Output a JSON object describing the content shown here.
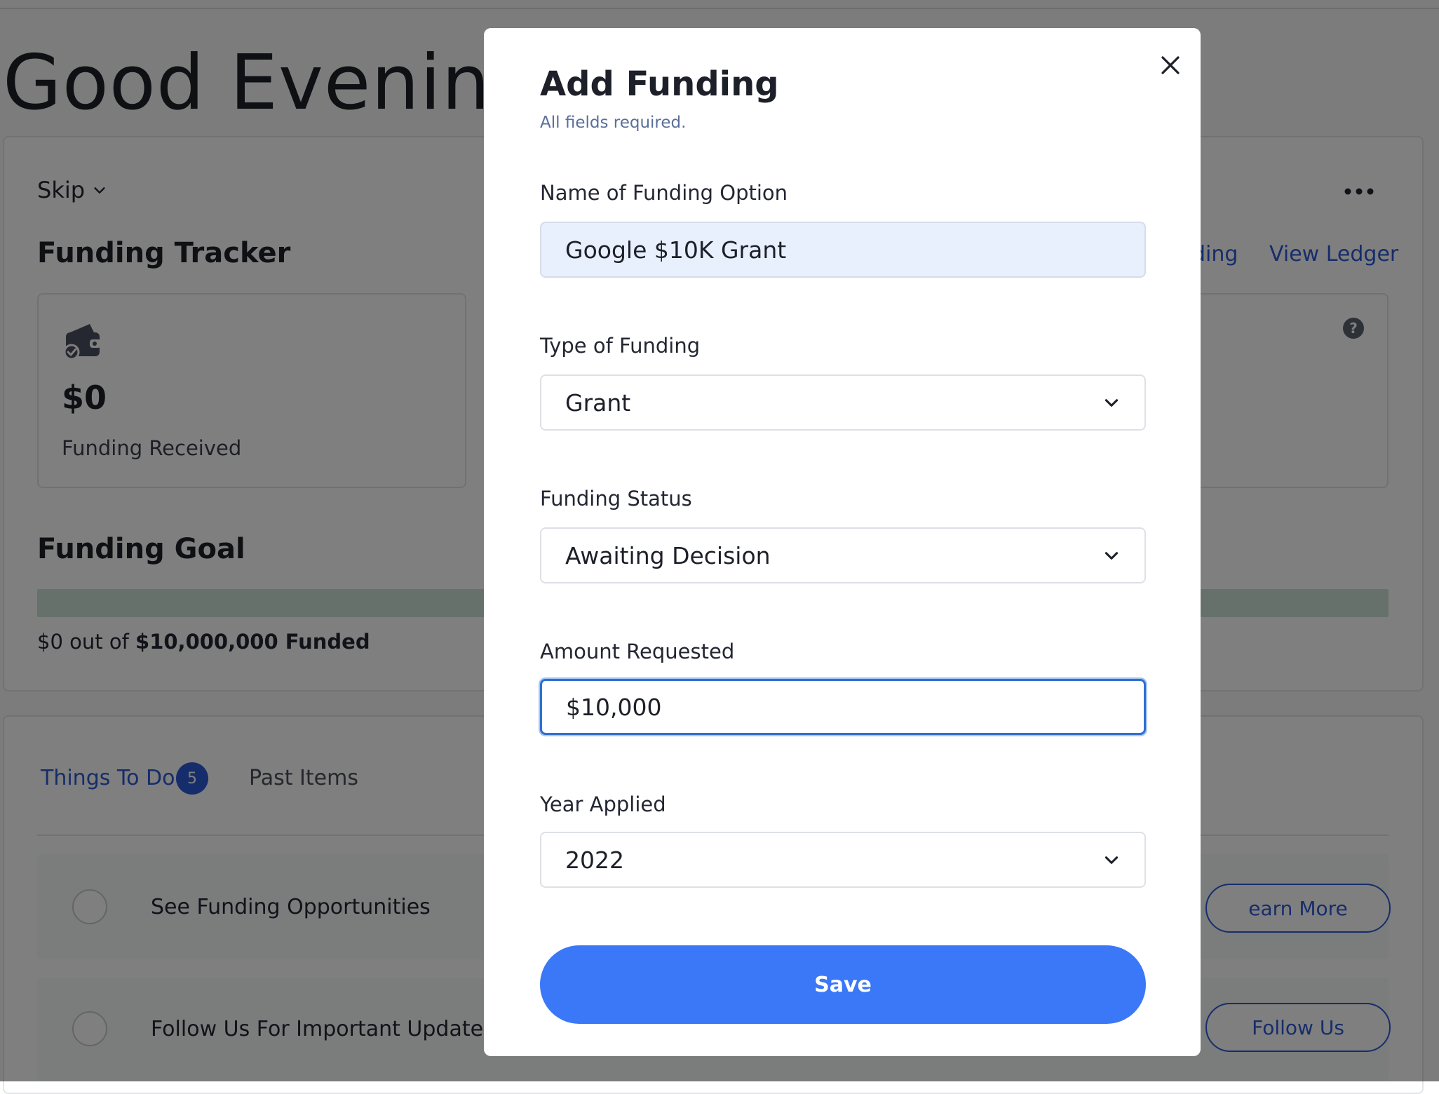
{
  "background": {
    "greeting": "Good Evening, S",
    "skip_label": "Skip",
    "funding_tracker": {
      "title": "Funding Tracker",
      "link_funding_partial": "ding",
      "link_ledger": "View Ledger",
      "received_amount": "$0",
      "received_label": "Funding Received"
    },
    "funding_goal": {
      "title": "Funding Goal",
      "progress_fraction": 0,
      "funded_prefix": "$0 out of ",
      "funded_goal": "$10,000,000 Funded"
    },
    "tabs": {
      "todo_label": "Things To Do",
      "todo_count": "5",
      "past_label": "Past Items"
    },
    "tasks": [
      {
        "label": "See Funding Opportunities",
        "button": "earn More"
      },
      {
        "label": "Follow Us For Important Updates",
        "button": "Follow Us"
      }
    ]
  },
  "modal": {
    "title": "Add Funding",
    "subtitle": "All fields required.",
    "fields": {
      "name": {
        "label": "Name of Funding Option",
        "value": "Google $10K Grant"
      },
      "type": {
        "label": "Type of Funding",
        "value": "Grant"
      },
      "status": {
        "label": "Funding Status",
        "value": "Awaiting Decision"
      },
      "amount": {
        "label": "Amount Requested",
        "value": "$10,000"
      },
      "year": {
        "label": "Year Applied",
        "value": "2022"
      }
    },
    "save_label": "Save"
  },
  "colors": {
    "accent": "#3b78f7",
    "link": "#2d5ad6",
    "overlay": "rgba(0,0,0,0.5)"
  },
  "icons": [
    "chevron-down-icon",
    "more-dots-icon",
    "wallet-icon",
    "help-icon",
    "close-icon"
  ]
}
